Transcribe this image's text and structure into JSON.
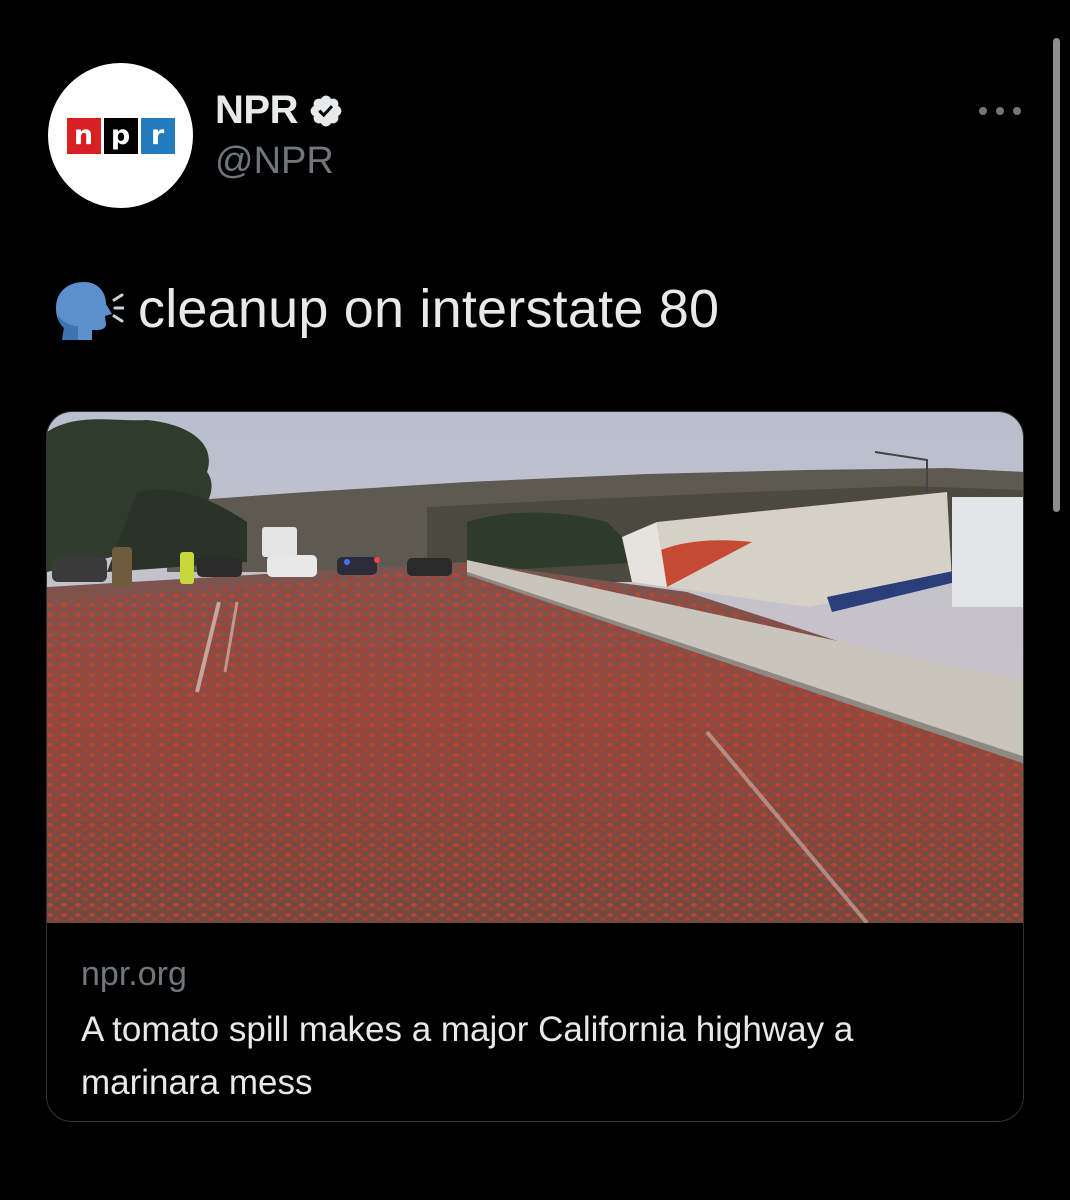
{
  "tweet": {
    "author": {
      "display_name": "NPR",
      "handle": "@NPR",
      "verified": true,
      "avatar_logo": [
        "n",
        "p",
        "r"
      ]
    },
    "text": "cleanup on interstate 80",
    "emoji": "speaking-head-icon",
    "card": {
      "domain": "npr.org",
      "title": "A tomato spill makes a major California highway a marinara mess"
    }
  },
  "colors": {
    "background": "#000000",
    "primary_text": "#e7e9ea",
    "secondary_text": "#71767b",
    "card_border": "#2f3336",
    "npr_red": "#d62021",
    "npr_black": "#000000",
    "npr_blue": "#237bbd"
  }
}
